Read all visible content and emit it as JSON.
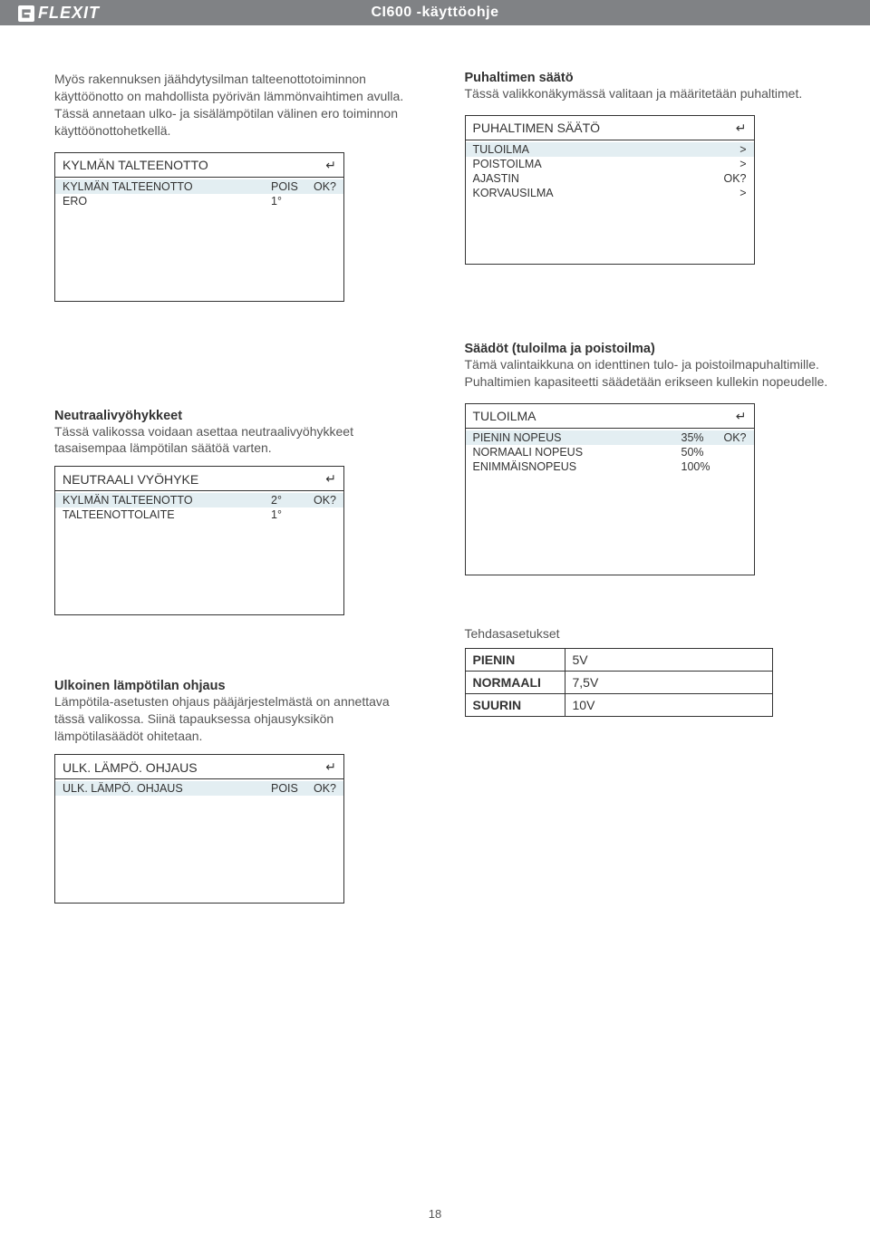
{
  "header": {
    "brand": "FLEXIT",
    "doc_title": "CI600 -käyttöohje"
  },
  "left": {
    "intro": "Myös rakennuksen jäähdytysilman talteenottotoiminnon käyttöönotto on mahdollista pyörivän lämmönvaihtimen avulla. Tässä annetaan ulko- ja sisälämpötilan välinen ero toiminnon käyttöönottohetkellä.",
    "panel1": {
      "title": "KYLMÄN TALTEENOTTO",
      "rows": [
        {
          "label": "KYLMÄN TALTEENOTTO",
          "val": "POIS",
          "ok": "OK?",
          "hi": true
        },
        {
          "label": "ERO",
          "val": "1°",
          "ok": ""
        }
      ]
    },
    "neutral_heading": "Neutraalivyöhykkeet",
    "neutral_para": "Tässä valikossa voidaan asettaa neutraalivyöhykkeet tasaisempaa lämpötilan säätöä varten.",
    "panel2": {
      "title": "NEUTRAALI VYÖHYKE",
      "rows": [
        {
          "label": "KYLMÄN TALTEENOTTO",
          "val": "2°",
          "ok": "OK?",
          "hi": true
        },
        {
          "label": "TALTEENOTTOLAITE",
          "val": "1°",
          "ok": ""
        }
      ]
    },
    "ext_heading": "Ulkoinen lämpötilan ohjaus",
    "ext_para": "Lämpötila-asetusten ohjaus pääjärjestelmästä on annettava tässä valikossa. Siinä tapauksessa ohjausyksikön lämpötilasäädöt ohitetaan.",
    "panel3": {
      "title": "ULK. LÄMPÖ. OHJAUS",
      "rows": [
        {
          "label": "ULK. LÄMPÖ. OHJAUS",
          "val": "POIS",
          "ok": "OK?",
          "hi": true
        }
      ]
    }
  },
  "right": {
    "fan_heading": "Puhaltimen säätö",
    "fan_para": "Tässä valikkonäkymässä valitaan ja määritetään puhaltimet.",
    "panel4": {
      "title": "PUHALTIMEN SÄÄTÖ",
      "rows": [
        {
          "label": "TULOILMA",
          "val": "",
          "ok": ">",
          "hi": true
        },
        {
          "label": "POISTOILMA",
          "val": "",
          "ok": ">"
        },
        {
          "label": "AJASTIN",
          "val": "",
          "ok": "OK?"
        },
        {
          "label": "KORVAUSILMA",
          "val": "",
          "ok": ">"
        }
      ]
    },
    "adj_heading": "Säädöt (tuloilma ja poistoilma)",
    "adj_para": "Tämä valintaikkuna on identtinen tulo- ja poistoilmapuhaltimille. Puhaltimien kapasiteetti säädetään erikseen kullekin nopeudelle.",
    "panel5": {
      "title": "TULOILMA",
      "rows": [
        {
          "label": "PIENIN NOPEUS",
          "val": "35%",
          "ok": "OK?",
          "hi": true
        },
        {
          "label": "NORMAALI NOPEUS",
          "val": "50%",
          "ok": ""
        },
        {
          "label": "ENIMMÄISNOPEUS",
          "val": "100%",
          "ok": ""
        }
      ]
    },
    "factory_heading": "Tehdasasetukset",
    "factory": [
      {
        "lab": "PIENIN",
        "val": "5V"
      },
      {
        "lab": "NORMAALI",
        "val": "7,5V"
      },
      {
        "lab": "SUURIN",
        "val": "10V"
      }
    ]
  },
  "page_number": "18",
  "return_glyph": "↵"
}
